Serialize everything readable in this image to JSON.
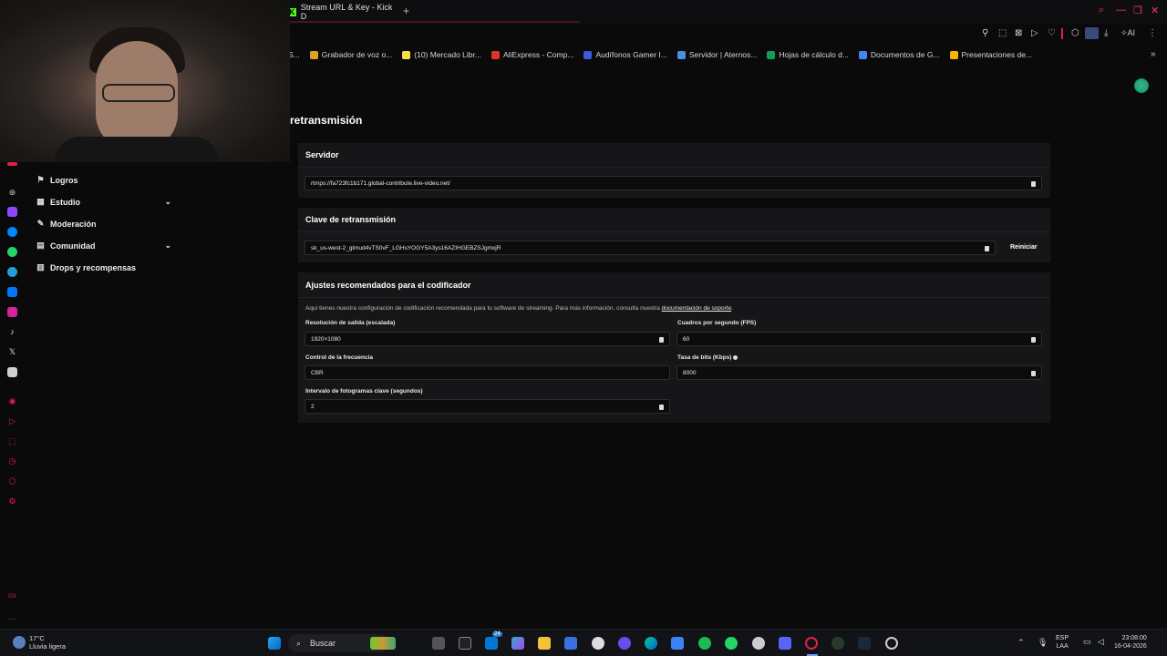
{
  "browser": {
    "tab_title": "Stream URL & Key - Kick D",
    "tab_favicon": "K",
    "new_tab_symbol": "+",
    "toolbar_ai_label": "AI",
    "bookmarks": [
      {
        "label": "S...",
        "color": "#888888"
      },
      {
        "label": "Grabador de voz o...",
        "color": "#e0a020"
      },
      {
        "label": "(10) Mercado Libr...",
        "color": "#f2e14b"
      },
      {
        "label": "AliExpress - Comp...",
        "color": "#e43225"
      },
      {
        "label": "Audífonos Gamer I...",
        "color": "#3b5bdb"
      },
      {
        "label": "Servidor | Aternos...",
        "color": "#4a90e2"
      },
      {
        "label": "Hojas de cálculo d...",
        "color": "#0f9d58"
      },
      {
        "label": "Documentos de G...",
        "color": "#4285f4"
      },
      {
        "label": "Presentaciones de...",
        "color": "#f4b400"
      }
    ]
  },
  "sidebar": {
    "items": [
      {
        "label": "Logros",
        "icon": "trophy-icon",
        "has_chevron": false
      },
      {
        "label": "Estudio",
        "icon": "studio-icon",
        "has_chevron": true
      },
      {
        "label": "Moderación",
        "icon": "wrench-icon",
        "has_chevron": false
      },
      {
        "label": "Comunidad",
        "icon": "community-icon",
        "has_chevron": true
      },
      {
        "label": "Drops y recompensas",
        "icon": "gift-icon",
        "has_chevron": false
      }
    ]
  },
  "main": {
    "heading": "retransmisión",
    "server": {
      "title": "Servidor",
      "value": "rtmps://fa723fc1b171.global-contribute.live-video.net/"
    },
    "stream_key": {
      "title": "Clave de retransmisión",
      "value": "sk_us-west-2_glmud4vTS0vF_LGHsYOGY5A3ys16AZIHGEBZSJgmxjR",
      "reset_label": "Reiniciar"
    },
    "encoder": {
      "title": "Ajustes recomendados para el codificador",
      "description": "Aquí tienes nuestra configuración de codificación recomendada para tu software de streaming. Para más información, consulta nuestra ",
      "link": "documentación de soporte",
      "link_suffix": ".",
      "resolution_label": "Resolución de salida (escalada)",
      "resolution_value": "1920×1080",
      "fps_label": "Cuadros por segundo (FPS)",
      "fps_value": "60",
      "rate_control_label": "Control de la frecuencia",
      "rate_control_value": "CBR",
      "bitrate_label": "Tasa de bits (Kbps)",
      "bitrate_value": "8000",
      "keyframe_label": "Intervalo de fotogramas clave (segundos)",
      "keyframe_value": "2"
    }
  },
  "taskbar": {
    "weather_temp": "17°C",
    "weather_desc": "Lluvia ligera",
    "search_label": "Buscar",
    "lang_top": "ESP",
    "lang_bottom": "LAA",
    "time": "23:08:00",
    "date": "16-04-2026",
    "chat_badge": "24"
  }
}
